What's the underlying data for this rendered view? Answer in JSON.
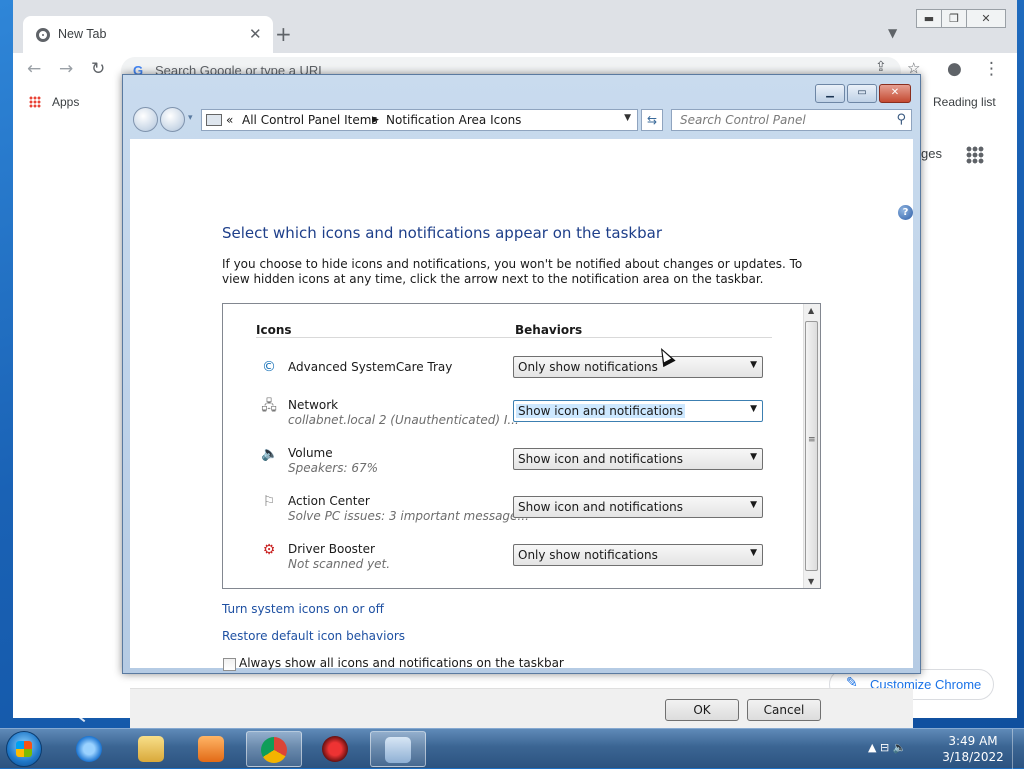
{
  "chrome": {
    "tab_title": "New Tab",
    "tab_close": "✕",
    "new_tab": "+",
    "omnibox_placeholder": "Search Google or type a URL",
    "apps_label": "Apps",
    "reading_list": "Reading list",
    "ntp_fragment": "ges",
    "customize_label": "Customize Chrome"
  },
  "control_panel": {
    "breadcrumbs": [
      "All Control Panel Items",
      "Notification Area Icons"
    ],
    "search_placeholder": "Search Control Panel",
    "heading": "Select which icons and notifications appear on the taskbar",
    "description": "If you choose to hide icons and notifications, you won't be notified about changes or updates. To view hidden icons at any time, click the arrow next to the notification area on the taskbar.",
    "columns": {
      "icons": "Icons",
      "behaviors": "Behaviors"
    },
    "rows": [
      {
        "name": "Advanced SystemCare Tray",
        "sub": "",
        "behavior": "Only show notifications",
        "icon": "systemcare-icon"
      },
      {
        "name": "Network",
        "sub": "collabnet.local 2 (Unauthenticated) I...",
        "behavior": "Show icon and notifications",
        "icon": "network-icon"
      },
      {
        "name": "Volume",
        "sub": "Speakers: 67%",
        "behavior": "Show icon and notifications",
        "icon": "speaker-icon"
      },
      {
        "name": "Action Center",
        "sub": "Solve PC issues: 3 important message...",
        "behavior": "Show icon and notifications",
        "icon": "flag-icon"
      },
      {
        "name": "Driver Booster",
        "sub": "Not scanned yet.",
        "behavior": "Only show notifications",
        "icon": "driver-booster-icon"
      }
    ],
    "link_system_icons": "Turn system icons on or off",
    "link_restore": "Restore default icon behaviors",
    "always_show_label": "Always show all icons and notifications on the taskbar",
    "always_show_checked": false,
    "ok_label": "OK",
    "cancel_label": "Cancel"
  },
  "taskbar": {
    "time": "3:49 AM",
    "date": "3/18/2022"
  },
  "colors": {
    "link": "#1e50a2",
    "heading": "#1e3f8a",
    "chrome_accent": "#1a73e8"
  }
}
